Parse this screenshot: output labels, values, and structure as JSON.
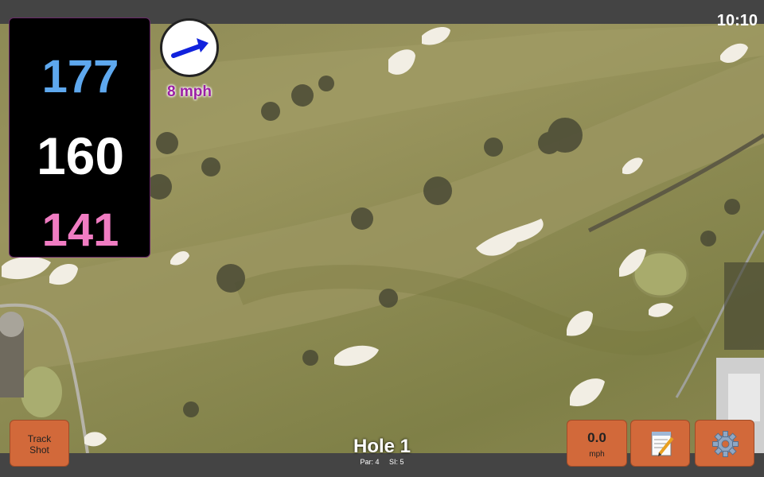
{
  "status_bar": {
    "time": "10:10"
  },
  "distances": {
    "back": "177",
    "middle": "160",
    "front": "141"
  },
  "wind": {
    "speed_label": "8 mph",
    "direction_icon": "arrow-up-right-icon"
  },
  "buttons": {
    "track_shot_line1": "Track",
    "track_shot_line2": "Shot",
    "wind_value": "0.0",
    "wind_unit": "mph",
    "notes_icon": "notepad-icon",
    "settings_icon": "gear-icon"
  },
  "hole": {
    "title": "Hole 1",
    "par": "Par: 4",
    "si": "SI: 5"
  },
  "colors": {
    "back": "#5ea8ee",
    "middle": "#ffffff",
    "front": "#f07cc2",
    "button": "#d2693a",
    "wind_text": "#9b1fa4"
  }
}
